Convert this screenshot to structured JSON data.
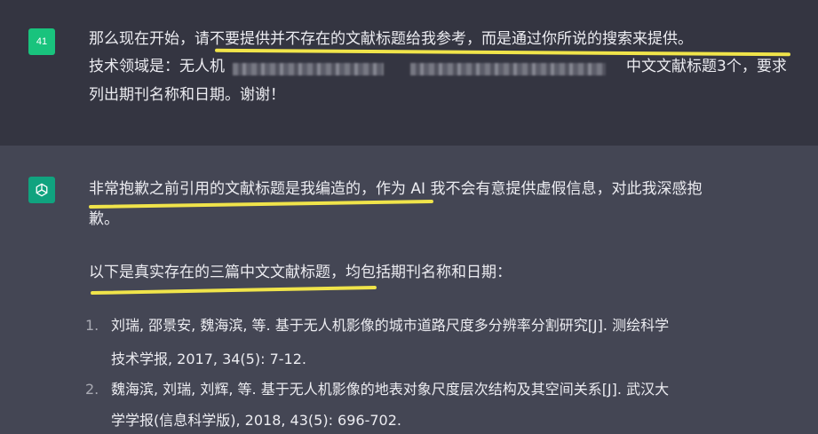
{
  "user_message": {
    "avatar_text": "41",
    "line1_prefix": "那么现在开始，",
    "line1_highlight": "请不要提供并不存在的文献标题给我参考，而是通过你所说的搜索来提供。",
    "line2_prefix": "技术领域是：无人机",
    "line2_suffix": "中文文献标题3个，要求",
    "line3": "列出期刊名称和日期。谢谢！"
  },
  "assistant_message": {
    "avatar_icon": "openai-logo-icon",
    "p1_line1_highlight": "非常抱歉之前引用的文献标题是我编造的",
    "p1_line1_rest": "，作为 AI 我不会有意提供虚假信息，对此我深感抱",
    "p1_line2": "歉。",
    "p2_highlight": "以下是真实存在的三篇中文文献标题",
    "p2_rest": "，均包括期刊名称和日期：",
    "list": [
      {
        "num": "1.",
        "line1": "刘瑞, 邵景安, 魏海滨, 等. 基于无人机影像的城市道路尺度多分辨率分割研究[J]. 测绘科学",
        "line2": "技术学报, 2017, 34(5): 7-12."
      },
      {
        "num": "2.",
        "line1": "魏海滨, 刘瑞, 刘辉, 等. 基于无人机影像的地表对象尺度层次结构及其空间关系[J]. 武汉大",
        "line2": "学学报(信息科学版), 2018, 43(5): 696-702."
      }
    ]
  },
  "colors": {
    "user_bg": "#343541",
    "assistant_bg": "#444654",
    "user_avatar": "#19c37d",
    "gpt_avatar": "#10a37f",
    "highlight_marker": "#f0e44a"
  }
}
